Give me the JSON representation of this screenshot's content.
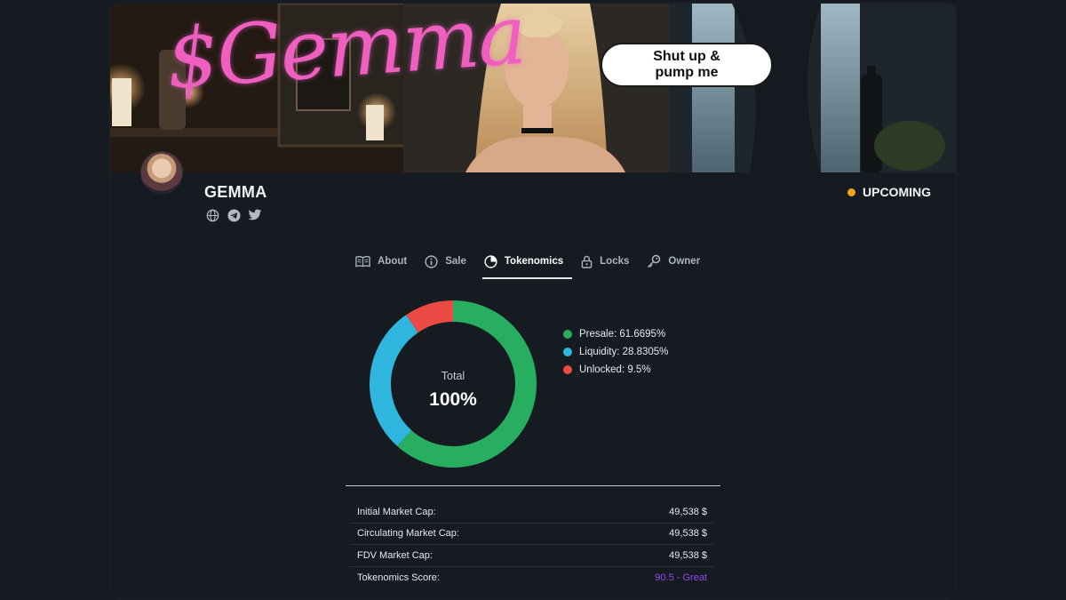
{
  "banner": {
    "title": "$Gemma",
    "speech_bubble": [
      "Shut up &",
      "pump me"
    ]
  },
  "project": {
    "name": "GEMMA",
    "status": "UPCOMING",
    "status_color": "#f2a516",
    "socials": [
      "globe-icon",
      "telegram-icon",
      "twitter-icon"
    ]
  },
  "tabs": [
    {
      "label": "About",
      "icon": "book-icon",
      "active": false
    },
    {
      "label": "Sale",
      "icon": "info-icon",
      "active": false
    },
    {
      "label": "Tokenomics",
      "icon": "pie-chart-icon",
      "active": true
    },
    {
      "label": "Locks",
      "icon": "lock-icon",
      "active": false
    },
    {
      "label": "Owner",
      "icon": "key-icon",
      "active": false
    }
  ],
  "chart_data": {
    "type": "pie",
    "center_label": "Total",
    "center_value": "100%",
    "slices": [
      {
        "name": "Presale",
        "value": 61.6695,
        "label": "Presale: 61.6695%",
        "color": "#27ae60"
      },
      {
        "name": "Liquidity",
        "value": 28.8305,
        "label": "Liquidity: 28.8305%",
        "color": "#2fb6de"
      },
      {
        "name": "Unlocked",
        "value": 9.5,
        "label": "Unlocked: 9.5%",
        "color": "#ec4a45"
      }
    ]
  },
  "stats": [
    {
      "label": "Initial Market Cap:",
      "value": "49,538 $"
    },
    {
      "label": "Circulating Market Cap:",
      "value": "49,538 $"
    },
    {
      "label": "FDV Market Cap:",
      "value": "49,538 $"
    },
    {
      "label": "Tokenomics Score:",
      "value": "90.5 - Great"
    }
  ],
  "colors": {
    "background": "#161b22",
    "score": "#8f4cf0"
  }
}
